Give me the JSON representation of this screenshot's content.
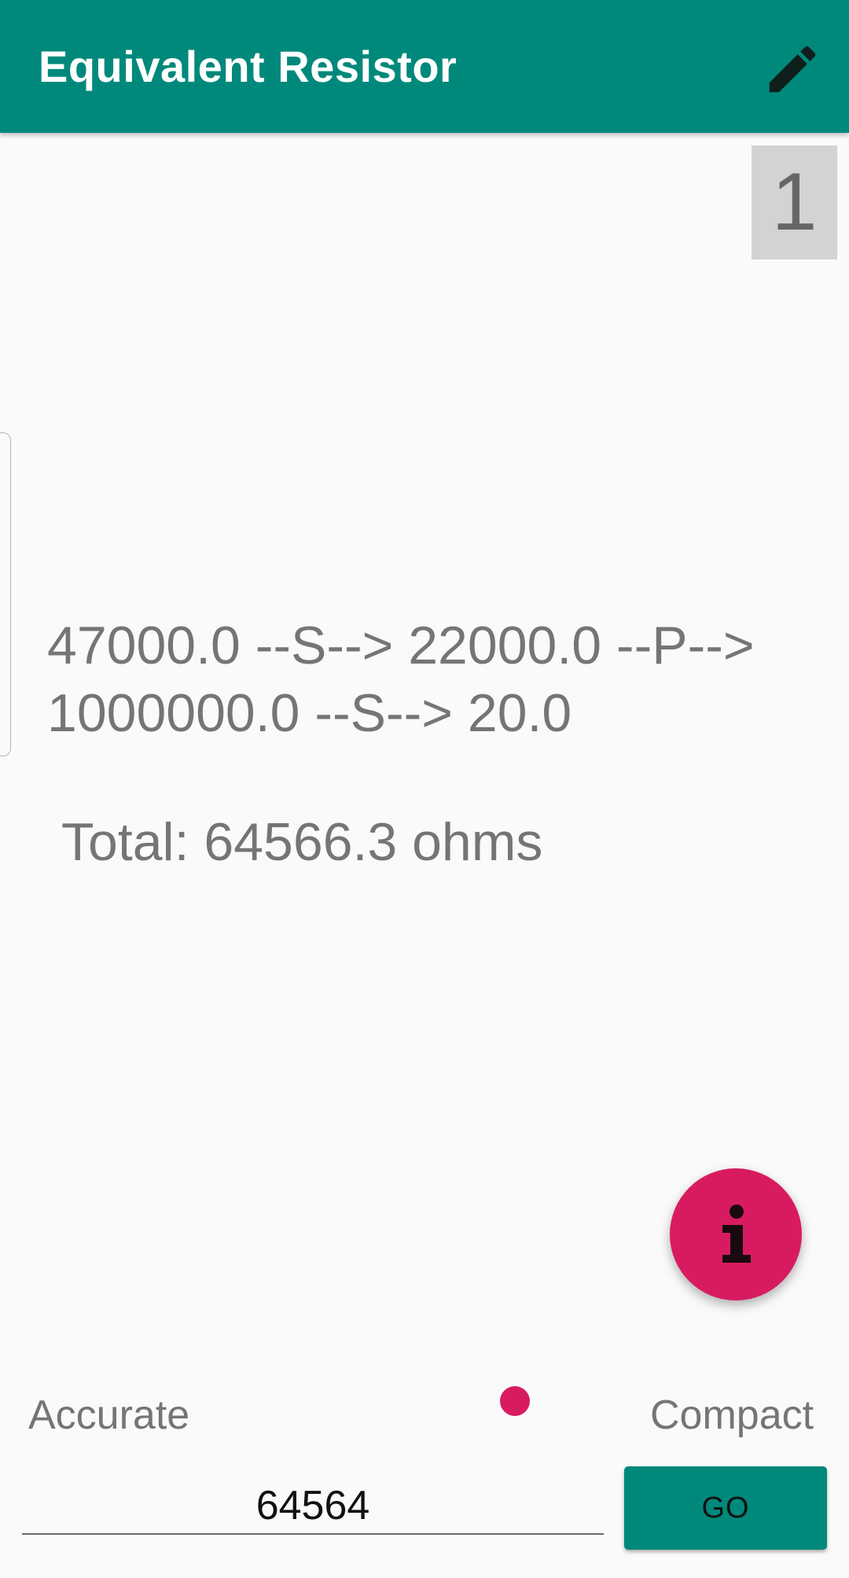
{
  "app": {
    "title": "Equivalent Resistor",
    "accent_color": "#00897b",
    "secondary_color": "#d81b60",
    "edit_icon": "pencil-icon",
    "info_icon": "info-icon"
  },
  "page_indicator": "1",
  "result": {
    "chain_line1": "47000.0 --S--> 22000.0 --P-->",
    "chain_line2": "1000000.0 --S--> 20.0",
    "total": "Total: 64566.3 ohms"
  },
  "mode": {
    "left_label": "Accurate",
    "right_label": "Compact"
  },
  "input": {
    "value": "64564"
  },
  "go_button": {
    "label": "GO"
  }
}
